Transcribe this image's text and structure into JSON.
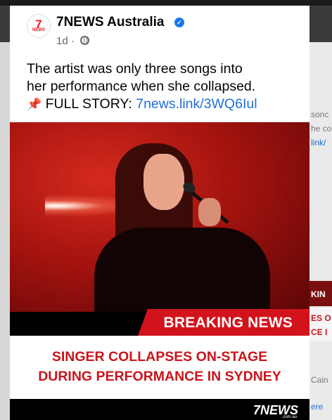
{
  "post": {
    "page_name": "7NEWS Australia",
    "time_ago": "1d",
    "caption_lines": [
      "The artist was only three songs into",
      "her performance when she collapsed."
    ],
    "full_story_label": "FULL STORY:",
    "link_text": "7news.link/3WQ6Iul"
  },
  "image": {
    "banner": "BREAKING NEWS",
    "headline_lines": [
      "SINGER COLLAPSES ON-STAGE",
      "DURING PERFORMANCE IN SYDNEY"
    ],
    "logo_text": "7NEWS",
    "logo_sub": ".com.au"
  },
  "avatar": {
    "brand_mark": "7",
    "brand_text": "NEWS"
  },
  "background_fragments": {
    "right_texts": [
      "sonc",
      "he co",
      "link/",
      "KIN",
      "ES O",
      "CE I",
      "Cain",
      "ere"
    ]
  },
  "colors": {
    "brand_red": "#d3131b",
    "link_blue": "#216fdb",
    "verified_blue": "#1877f2"
  }
}
